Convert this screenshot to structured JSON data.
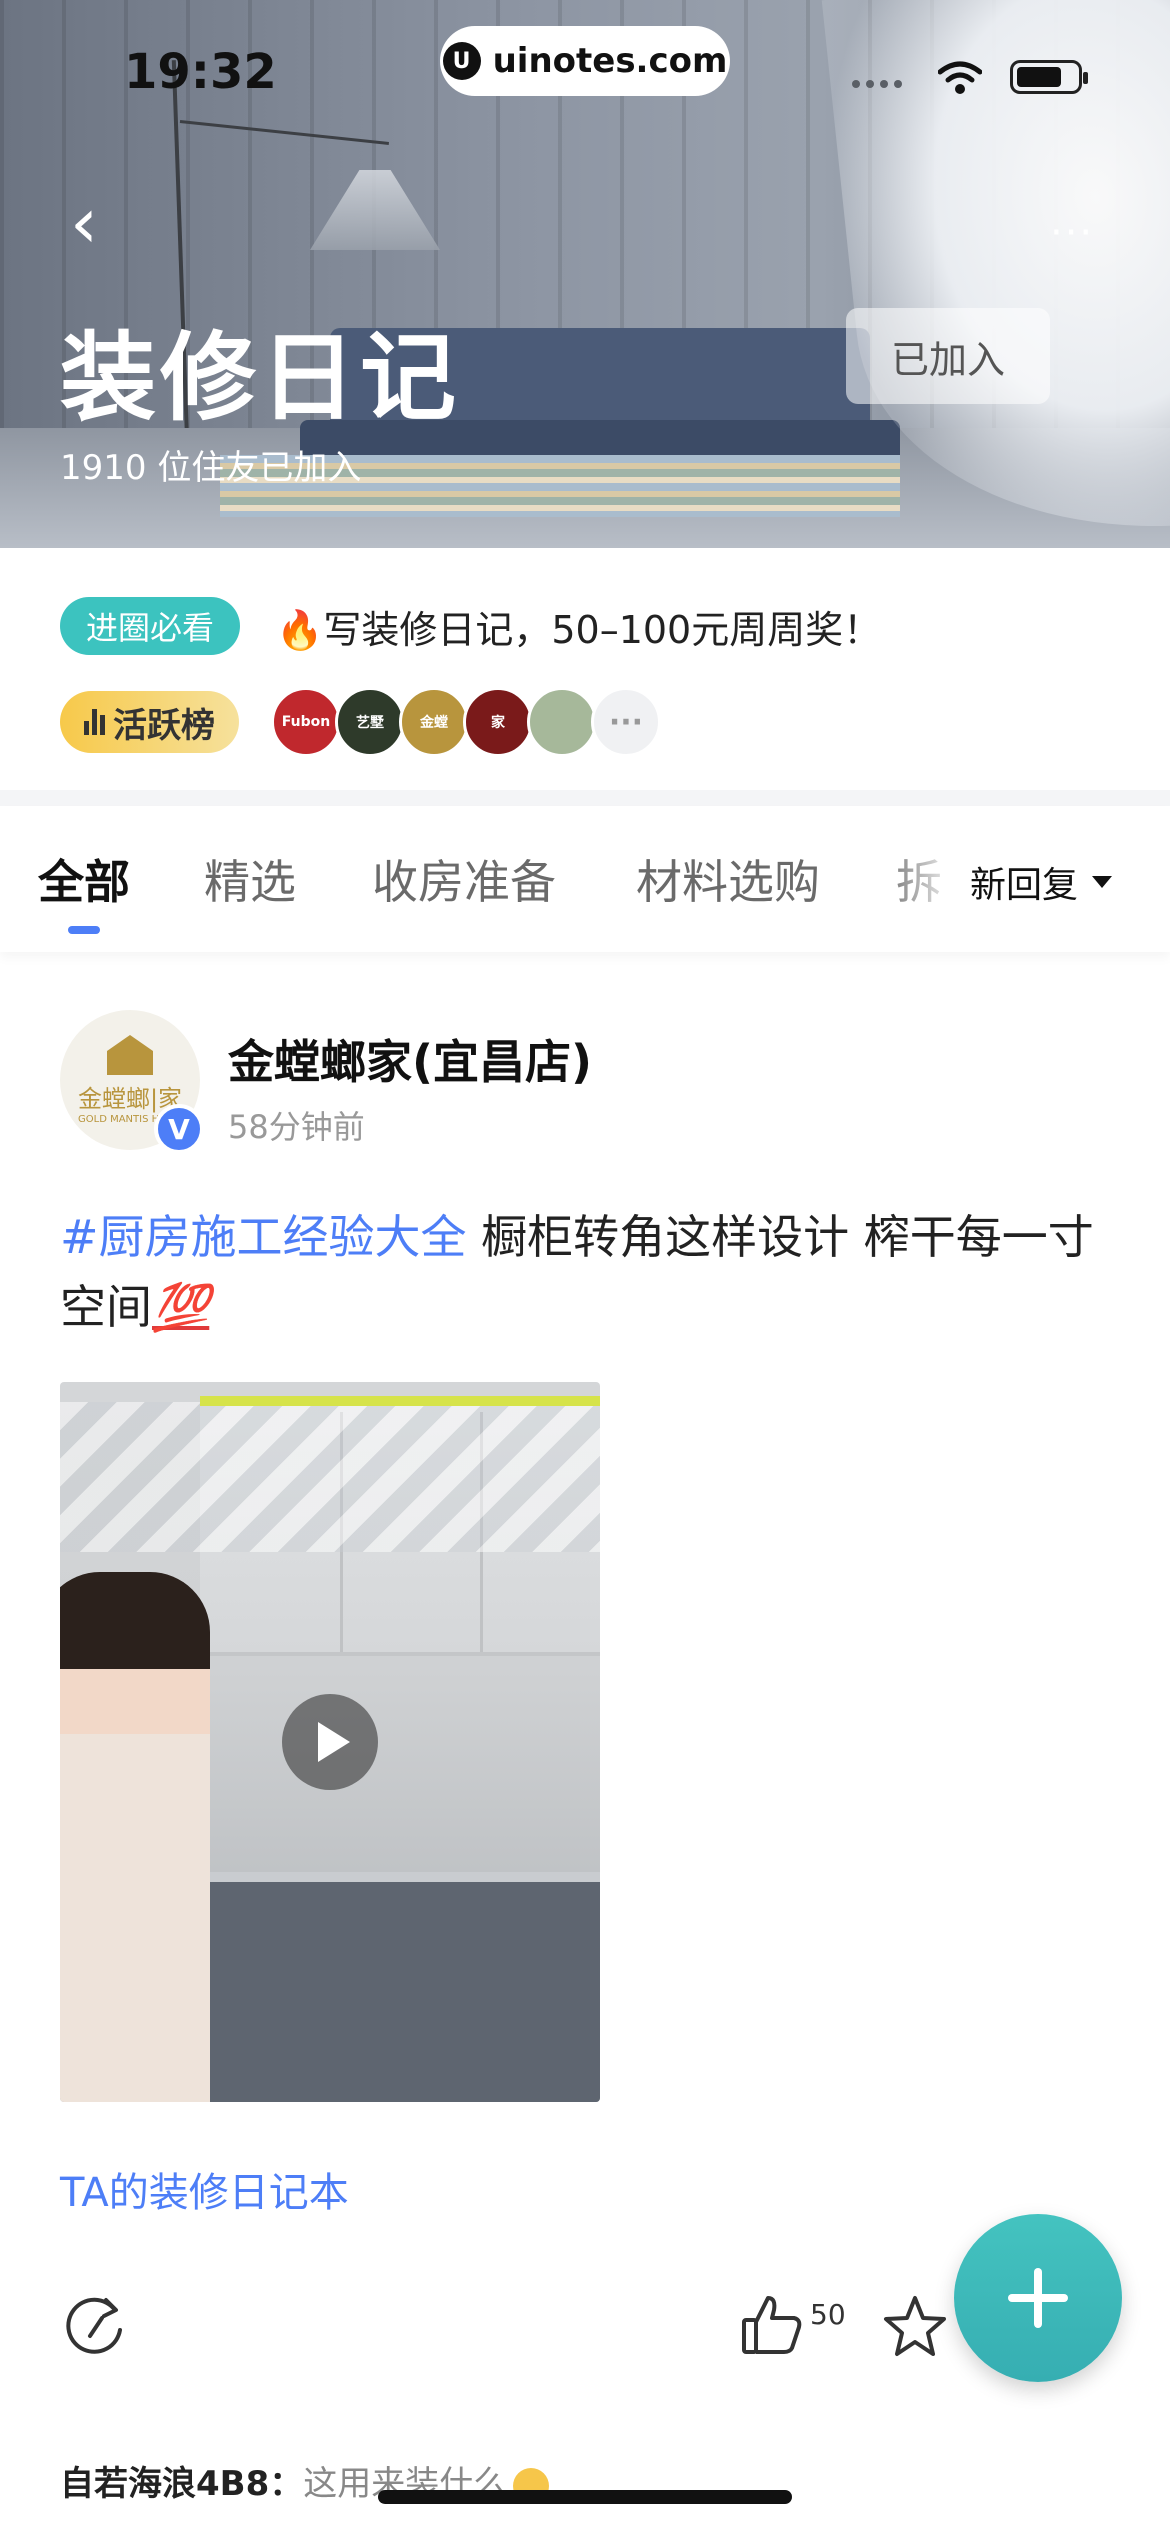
{
  "status_bar": {
    "time": "19:32",
    "url": "uinotes.com",
    "url_logo": "U"
  },
  "header": {
    "title": "装修日记",
    "member_count": "1910 位住友已加入",
    "joined_label": "已加入",
    "back_icon": "‹",
    "more_icon": "···"
  },
  "notice": {
    "tag": "进圈必看",
    "fire": "🔥",
    "text": "写装修日记，50–100元周周奖！"
  },
  "ranking": {
    "tag": "活跃榜",
    "avatars": [
      {
        "label": "Fubon",
        "color": "#c0282d"
      },
      {
        "label": "艺墅",
        "color": "#2e3a2a"
      },
      {
        "label": "金螳",
        "color": "#b8953d"
      },
      {
        "label": "家",
        "color": "#7a1a1a"
      },
      {
        "label": "",
        "color": "#a6b89a"
      }
    ],
    "more": "···"
  },
  "tabs": {
    "items": [
      "全部",
      "精选",
      "收房准备",
      "材料选购",
      "拆"
    ],
    "active": "全部",
    "sort_label": "新回复"
  },
  "post": {
    "author": "金螳螂家(宜昌店)",
    "avatar_brand": "金螳螂|家",
    "avatar_sub": "GOLD MANTIS HOME",
    "verified_mark": "V",
    "time": "58分钟前",
    "hashtag": "#厨房施工经验大全",
    "text": " 橱柜转角这样设计  榨干每一寸空间",
    "emoji": "💯",
    "diary_link": "TA的装修日记本",
    "like_count": "50"
  },
  "comment": {
    "user": "自若海浪4B8：",
    "text": "这用来装什么"
  },
  "colors": {
    "accent": "#4d7ef7",
    "teal": "#3cc3bf",
    "fab": "#44c3c0"
  }
}
